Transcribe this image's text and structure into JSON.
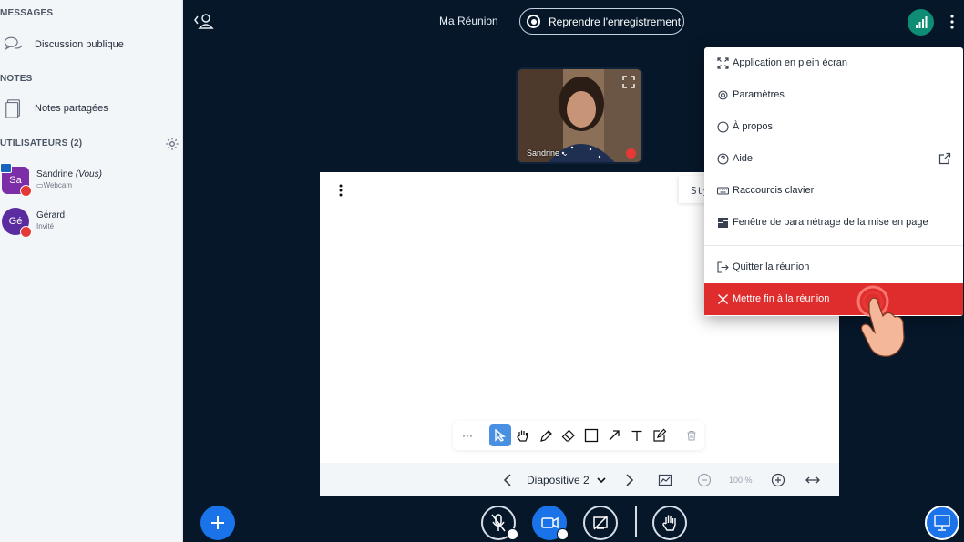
{
  "sidebar": {
    "messages_title": "MESSAGES",
    "public_chat": "Discussion publique",
    "notes_title": "NOTES",
    "shared_notes": "Notes partagées",
    "users_title": "UTILISATEURS (2)",
    "users": [
      {
        "initials": "Sa",
        "name": "Sandrine",
        "tag": "(Vous)",
        "sub": "Webcam",
        "color": "#7b2ea8"
      },
      {
        "initials": "Gé",
        "name": "Gérard",
        "tag": "",
        "sub": "Invité",
        "color": "#5a2ca0"
      }
    ]
  },
  "topbar": {
    "meeting_title": "Ma Réunion",
    "record_label": "Reprendre l'enregistrement"
  },
  "webcam": {
    "name": "Sandrine"
  },
  "whiteboard": {
    "style_label": "Sty",
    "more_label": "···",
    "slide_label": "Diapositive 2",
    "zoom_label": "100 %"
  },
  "menu": {
    "items": [
      {
        "label": "Application en plein écran",
        "icon": "fullscreen-icon"
      },
      {
        "label": "Paramètres",
        "icon": "gear-icon"
      },
      {
        "label": "À propos",
        "icon": "info-icon"
      },
      {
        "label": "Aide",
        "icon": "help-icon"
      },
      {
        "label": "Raccourcis clavier",
        "icon": "keyboard-icon"
      },
      {
        "label": "Fenêtre de paramétrage de la mise en page",
        "icon": "layout-icon"
      },
      {
        "label": "Quitter la réunion",
        "icon": "logout-icon"
      },
      {
        "label": "Mettre fin à la réunion",
        "icon": "close-icon"
      }
    ]
  },
  "colors": {
    "bg": "#06172a",
    "accent": "#1a73e8",
    "danger": "#df2d2d",
    "connection": "#0e8c74"
  }
}
